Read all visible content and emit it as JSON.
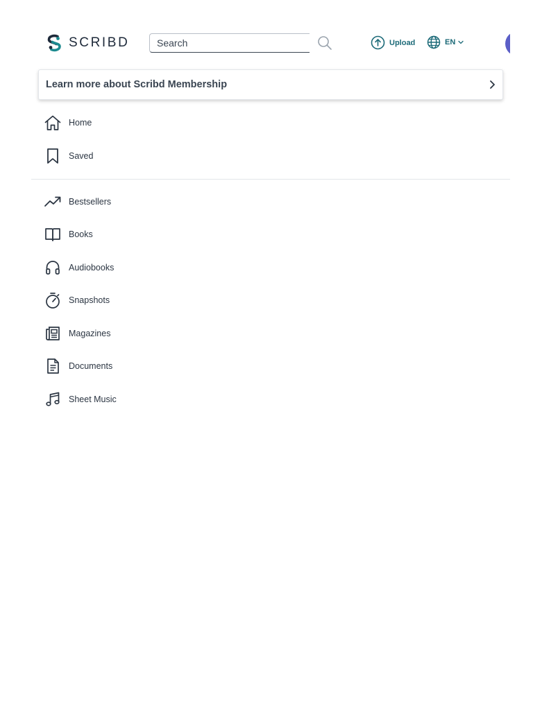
{
  "header": {
    "logo_text": "SCRIBD",
    "search": {
      "placeholder": "Search",
      "value": ""
    },
    "upload_label": "Upload",
    "language_label": "EN"
  },
  "banner": {
    "label": "Learn more about Scribd Membership"
  },
  "nav": {
    "primary": [
      {
        "label": "Home",
        "icon": "home-icon"
      },
      {
        "label": "Saved",
        "icon": "bookmark-icon"
      }
    ],
    "categories": [
      {
        "label": "Bestsellers",
        "icon": "trending-up-icon"
      },
      {
        "label": "Books",
        "icon": "book-icon"
      },
      {
        "label": "Audiobooks",
        "icon": "headphones-icon"
      },
      {
        "label": "Snapshots",
        "icon": "stopwatch-icon"
      },
      {
        "label": "Magazines",
        "icon": "magazine-icon"
      },
      {
        "label": "Documents",
        "icon": "document-icon"
      },
      {
        "label": "Sheet Music",
        "icon": "music-note-icon"
      }
    ]
  },
  "colors": {
    "brand_teal": "#1c6a78",
    "text_dark": "#1e2a3a",
    "avatar": "#5b5fc7"
  }
}
